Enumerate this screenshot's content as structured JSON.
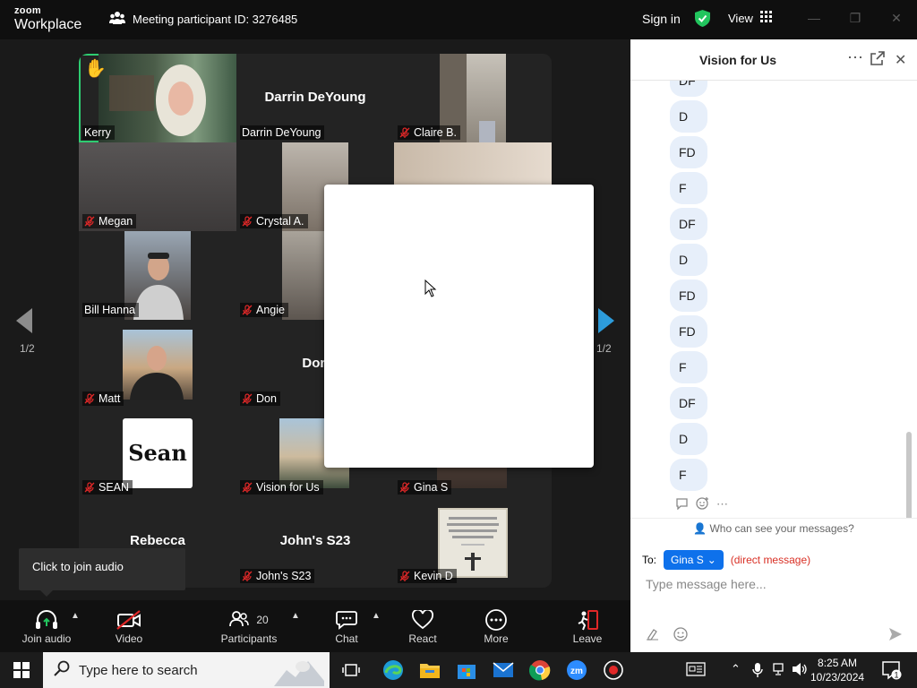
{
  "titlebar": {
    "logo_line1": "zoom",
    "logo_line2": "Workplace",
    "meeting_id": "Meeting participant ID: 3276485",
    "sign_in": "Sign in",
    "view": "View",
    "colors": {
      "shield": "#22c55e"
    }
  },
  "gallery": {
    "page_left": "1/2",
    "page_right": "1/2",
    "tiles": [
      {
        "name": "Kerry",
        "display": "",
        "muted": false,
        "hand_raised": true,
        "active": true
      },
      {
        "name": "Darrin DeYoung",
        "display": "Darrin DeYoung",
        "muted": false
      },
      {
        "name": "Claire B.",
        "display": "",
        "muted": true
      },
      {
        "name": "Megan",
        "display": "",
        "muted": true
      },
      {
        "name": "Crystal A.",
        "display": "",
        "muted": true
      },
      {
        "name": "",
        "display": "",
        "muted": false
      },
      {
        "name": "Bill Hanna",
        "display": "",
        "muted": false
      },
      {
        "name": "Angie",
        "display": "",
        "muted": true
      },
      {
        "name": "",
        "display": "",
        "muted": false
      },
      {
        "name": "Matt",
        "display": "",
        "muted": true
      },
      {
        "name": "Don",
        "display": "Don",
        "muted": true
      },
      {
        "name": "",
        "display": "",
        "muted": false
      },
      {
        "name": "SEAN",
        "display": "",
        "muted": true,
        "card_text": "Sean"
      },
      {
        "name": "Vision for Us",
        "display": "",
        "muted": true
      },
      {
        "name": "Gina S",
        "display": "",
        "muted": true
      },
      {
        "name": "",
        "display": "Rebecca",
        "muted": false
      },
      {
        "name": "John's S23",
        "display": "John's S23",
        "muted": true
      },
      {
        "name": "Kevin D",
        "display": "",
        "muted": true
      }
    ]
  },
  "tooltip": "Click to join audio",
  "toolbar": {
    "join_audio": "Join audio",
    "video": "Video",
    "participants": "Participants",
    "participant_count": "20",
    "chat": "Chat",
    "react": "React",
    "more": "More",
    "leave": "Leave",
    "colors": {
      "leave": "#e02828",
      "video_off": "#e02828"
    }
  },
  "chat": {
    "title": "Vision for Us",
    "messages": [
      "DF",
      "D",
      "FD",
      "F",
      "DF",
      "D",
      "FD",
      "FD",
      "F",
      "DF",
      "D",
      "F"
    ],
    "who_can_see": "Who can see your messages?",
    "to_label": "To:",
    "to_value": "Gina S",
    "direct_note": "(direct message)",
    "input_placeholder": "Type message here..."
  },
  "taskbar": {
    "search_placeholder": "Type here to search",
    "time": "8:25 AM",
    "date": "10/23/2024",
    "notification_count": "1",
    "zoom_app_label": "zm"
  }
}
